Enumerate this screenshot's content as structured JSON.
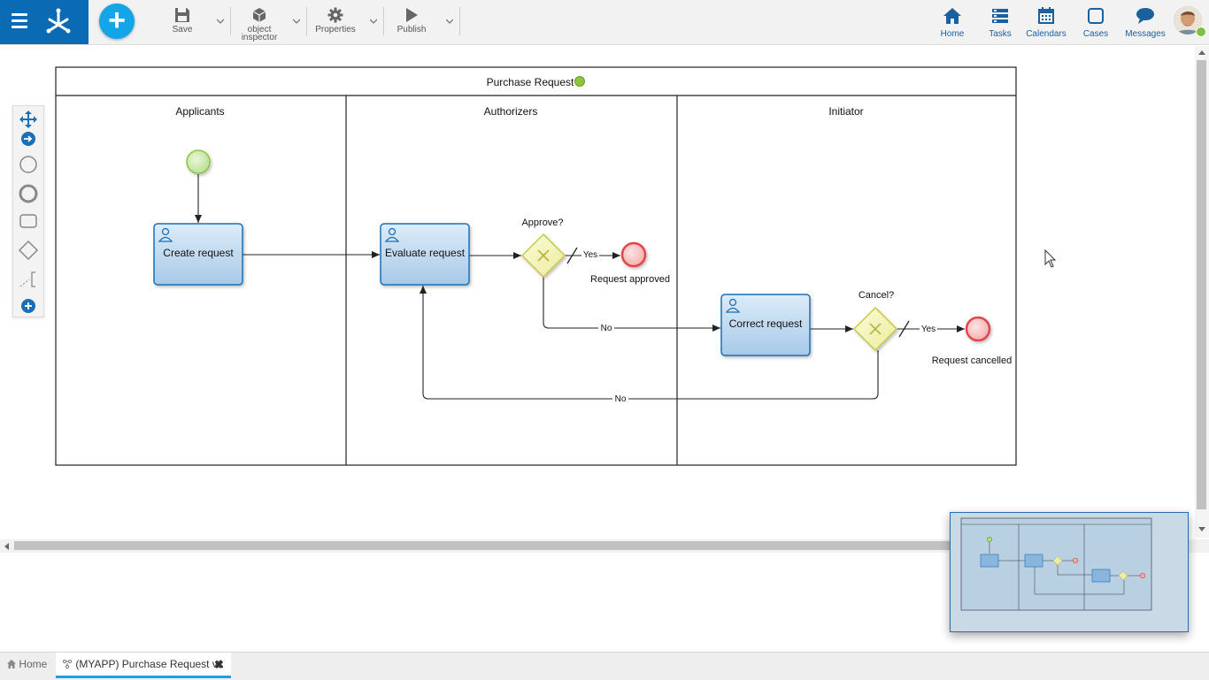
{
  "toolbar": {
    "save": "Save",
    "object_inspector_line1": "object",
    "object_inspector_line2": "inspector",
    "properties": "Properties",
    "publish": "Publish",
    "accent_color": "#0a6ab3",
    "add_button_color": "#12a5e8"
  },
  "nav": {
    "home": "Home",
    "tasks": "Tasks",
    "calendars": "Calendars",
    "cases": "Cases",
    "messages": "Messages"
  },
  "diagram": {
    "pool_title": "Purchase Request",
    "lanes": [
      "Applicants",
      "Authorizers",
      "Initiator"
    ],
    "tasks": {
      "create": "Create request",
      "evaluate": "Evaluate request",
      "correct": "Correct request"
    },
    "gateways": {
      "approve": "Approve?",
      "cancel": "Cancel?"
    },
    "end_events": {
      "approved": "Request approved",
      "cancelled": "Request cancelled"
    },
    "flow_labels": {
      "yes1": "Yes",
      "no1": "No",
      "yes2": "Yes",
      "no2": "No"
    }
  },
  "palette": {
    "tools": [
      "move-icon",
      "connect-icon",
      "start-event-icon",
      "end-event-icon",
      "task-icon",
      "gateway-icon",
      "annotation-icon",
      "more-icon"
    ]
  },
  "tabs": {
    "home": "Home",
    "document": "(MYAPP) Purchase Request v1"
  }
}
